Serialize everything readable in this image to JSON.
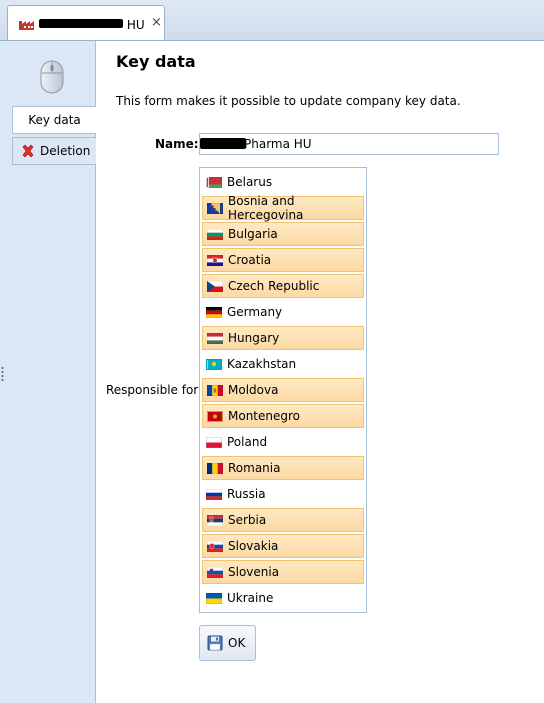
{
  "tab": {
    "title_suffix": "HU",
    "close": "×"
  },
  "nav": {
    "key_data": "Key data",
    "deletion": "Deletion"
  },
  "form": {
    "title": "Key data",
    "description": "This form makes it possible to update company key data.",
    "name_label": "Name:",
    "name_value": "Pharma HU",
    "responsible_label": "Responsible for:",
    "countries": [
      {
        "name": "Belarus",
        "selected": false,
        "flag": "belarus-flag"
      },
      {
        "name": "Bosnia and Hercegovina",
        "selected": true,
        "flag": "bosnia-flag"
      },
      {
        "name": "Bulgaria",
        "selected": true,
        "flag": "bulgaria-flag"
      },
      {
        "name": "Croatia",
        "selected": true,
        "flag": "croatia-flag"
      },
      {
        "name": "Czech Republic",
        "selected": true,
        "flag": "czech-flag"
      },
      {
        "name": "Germany",
        "selected": false,
        "flag": "germany-flag"
      },
      {
        "name": "Hungary",
        "selected": true,
        "flag": "hungary-flag"
      },
      {
        "name": "Kazakhstan",
        "selected": false,
        "flag": "kazakhstan-flag"
      },
      {
        "name": "Moldova",
        "selected": true,
        "flag": "moldova-flag"
      },
      {
        "name": "Montenegro",
        "selected": true,
        "flag": "montenegro-flag"
      },
      {
        "name": "Poland",
        "selected": false,
        "flag": "poland-flag"
      },
      {
        "name": "Romania",
        "selected": true,
        "flag": "romania-flag"
      },
      {
        "name": "Russia",
        "selected": false,
        "flag": "russia-flag"
      },
      {
        "name": "Serbia",
        "selected": true,
        "flag": "serbia-flag"
      },
      {
        "name": "Slovakia",
        "selected": true,
        "flag": "slovakia-flag"
      },
      {
        "name": "Slovenia",
        "selected": true,
        "flag": "slovenia-flag"
      },
      {
        "name": "Ukraine",
        "selected": false,
        "flag": "ukraine-flag"
      }
    ],
    "ok_label": "OK"
  }
}
